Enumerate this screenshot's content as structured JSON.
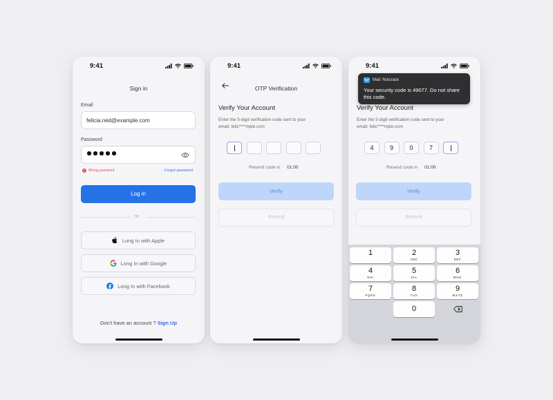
{
  "status_bar": {
    "time": "9:41"
  },
  "sign_in": {
    "title": "Sign in",
    "email_label": "Email",
    "email_value": "felicia.reid@example.com",
    "password_label": "Password",
    "error_text": "Wrong password",
    "forgot_link": "Forgot password",
    "login_button": "Log in",
    "or_text": "OR",
    "social": {
      "apple": "Long In with Apple",
      "google": "Long In with Google",
      "facebook": "Long In with Facebook"
    },
    "footer_text": "Don't have an account ?",
    "signup_link": "Sign Up"
  },
  "otp": {
    "nav_title": "OTP Verification",
    "heading": "Verify Your Account",
    "description_line1": "Enter the 5-digit verification code sent to your",
    "description_line2": "email: felic****mple.com",
    "resend_label": "Resend code in",
    "timer": "01:00",
    "verify_button": "Verify",
    "resend_button": "Resend"
  },
  "otp_filled": {
    "digits": [
      "4",
      "9",
      "0",
      "7",
      ""
    ]
  },
  "notification": {
    "app": "Mail: Nutcrack",
    "message": "Your security code is 49077. Do not share this code."
  },
  "keypad": {
    "keys": [
      {
        "num": "1",
        "letters": ""
      },
      {
        "num": "2",
        "letters": "ABC"
      },
      {
        "num": "3",
        "letters": "DEF"
      },
      {
        "num": "4",
        "letters": "GHI"
      },
      {
        "num": "5",
        "letters": "JKL"
      },
      {
        "num": "6",
        "letters": "MNO"
      },
      {
        "num": "7",
        "letters": "PQRS"
      },
      {
        "num": "8",
        "letters": "TUV"
      },
      {
        "num": "9",
        "letters": "WXYZ"
      },
      {
        "num": "0",
        "letters": ""
      }
    ]
  },
  "colors": {
    "primary": "#2472e6",
    "primary_light": "#bfd6fb",
    "error": "#e14a4a",
    "link": "#2f6fe0"
  }
}
